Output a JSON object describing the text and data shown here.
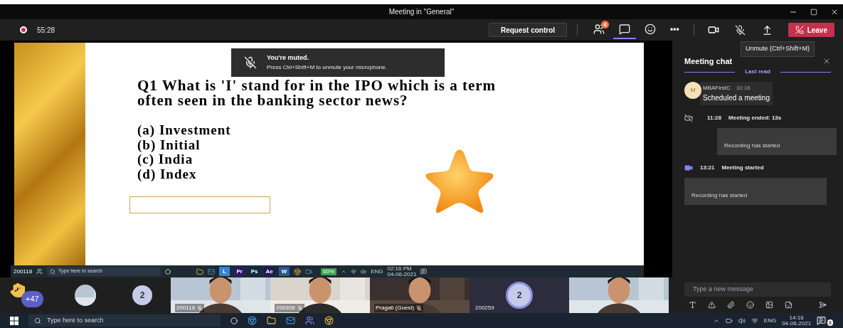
{
  "window": {
    "title": "Meeting in \"General\""
  },
  "toolbar": {
    "recording": true,
    "timer": "55:28",
    "request_control": "Request control",
    "tools": [
      {
        "kind": "people",
        "badge": "4",
        "selected": false
      },
      {
        "kind": "chat",
        "selected": true
      },
      {
        "kind": "reactions",
        "selected": false
      },
      {
        "kind": "more",
        "label": "•••",
        "selected": false
      }
    ],
    "camera_on": true,
    "mic_muted": true,
    "leave": "Leave",
    "tooltip": "Unmute (Ctrl+Shift+M)"
  },
  "toast": {
    "title": "You're muted.",
    "message": "Press Ctrl+Shift+M to unmute your microphone."
  },
  "slide": {
    "question": "Q1 What is 'I' stand for in the IPO which is a term often seen in the banking sector news?",
    "options": [
      "(a) Investment",
      "(b) Initial",
      "(c) India",
      "(d) Index"
    ]
  },
  "shared_taskbar": {
    "user": "200118",
    "search": "Type here to search",
    "apps": [
      {
        "label": "L",
        "color": "#2b88d8"
      },
      {
        "label": "Pr",
        "color": "#2a1a6b"
      },
      {
        "label": "Ps",
        "color": "#0e2a47"
      },
      {
        "label": "Ae",
        "color": "#1f1a5c"
      },
      {
        "label": "W",
        "color": "#2b5797"
      }
    ],
    "battery": "60%",
    "language": "ENG",
    "time": "02:16 PM",
    "date": "04-06-2021"
  },
  "participants": [
    {
      "kind": "raise",
      "badge": "+47"
    },
    {
      "kind": "avatar"
    },
    {
      "kind": "count",
      "label": "2"
    },
    {
      "kind": "video",
      "name": "200118",
      "muted": true
    },
    {
      "kind": "video",
      "name": "200306",
      "muted": true
    },
    {
      "kind": "video",
      "name": "Pragati (Guest)",
      "muted": true
    },
    {
      "kind": "ring",
      "label": "2",
      "name": "200259"
    },
    {
      "kind": "video"
    }
  ],
  "chat": {
    "title": "Meeting chat",
    "divider": "Last read",
    "items": [
      {
        "kind": "message",
        "initial": "M",
        "author": "MBAFirstC",
        "time": "10:16",
        "text": "Scheduled a meeting"
      },
      {
        "kind": "meeting_ended",
        "time": "11:28",
        "text": "Meeting ended: 13s",
        "card": "Recording has started"
      },
      {
        "kind": "meeting_started",
        "time": "13:21",
        "text": "Meeting started",
        "card": "Recording has started"
      }
    ],
    "compose": {
      "placeholder": "Type a new message"
    }
  },
  "taskbar": {
    "search": "Type here to search",
    "language": "ENG",
    "time": "14:16",
    "date": "04-06-2021",
    "notifications": "8"
  }
}
